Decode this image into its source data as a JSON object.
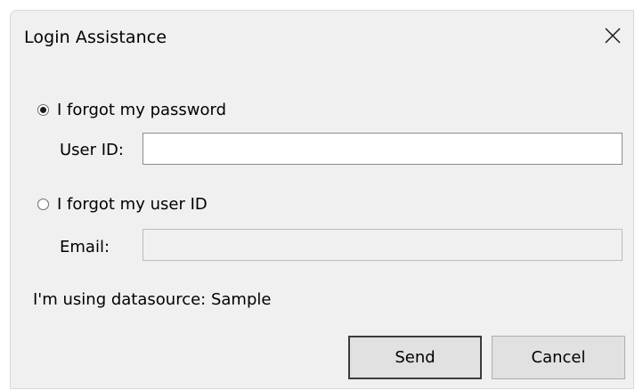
{
  "window": {
    "title": "Login Assistance",
    "close_icon": "close-icon"
  },
  "options": {
    "forgot_password": {
      "label": "I forgot my password",
      "selected": true,
      "field_label": "User ID:",
      "field_value": "",
      "field_enabled": true
    },
    "forgot_userid": {
      "label": "I forgot my user ID",
      "selected": false,
      "field_label": "Email:",
      "field_value": "",
      "field_enabled": false
    }
  },
  "status": {
    "text": "I'm using datasource: Sample"
  },
  "buttons": {
    "send_label": "Send",
    "cancel_label": "Cancel"
  }
}
